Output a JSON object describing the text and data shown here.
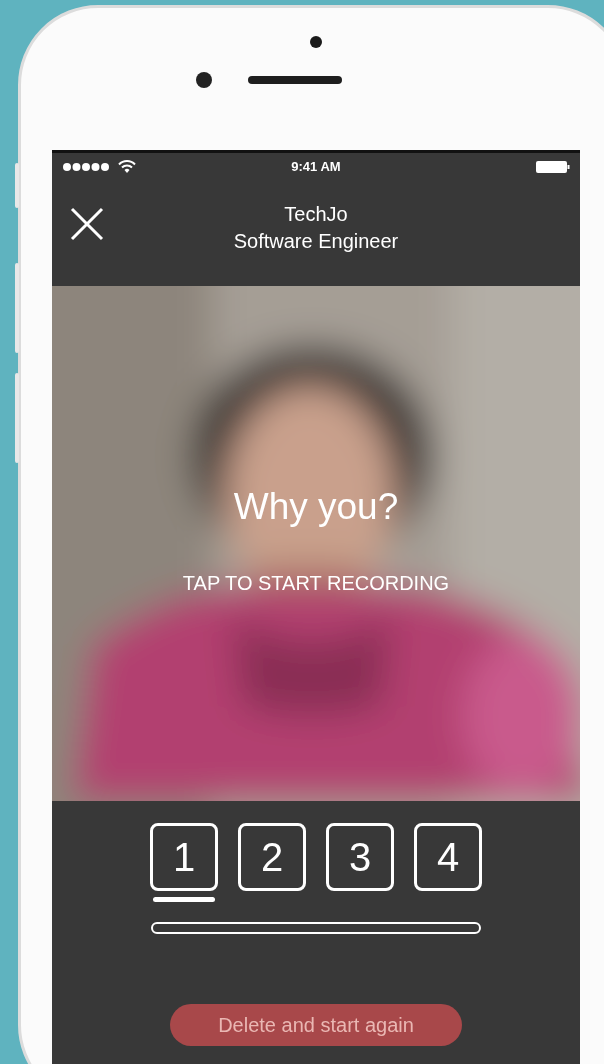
{
  "status_bar": {
    "time": "9:41 AM"
  },
  "header": {
    "title": "TechJo",
    "subtitle": "Software Engineer"
  },
  "camera": {
    "kind": "picture",
    "prompt": "Why you?",
    "hint": "TAP TO START RECORDING"
  },
  "steps": [
    {
      "label": "1",
      "selected": true
    },
    {
      "label": "2",
      "selected": false
    },
    {
      "label": "3",
      "selected": false
    },
    {
      "label": "4",
      "selected": false
    }
  ],
  "progress": {
    "level": 0
  },
  "delete_button": {
    "label": "Delete and start again"
  }
}
